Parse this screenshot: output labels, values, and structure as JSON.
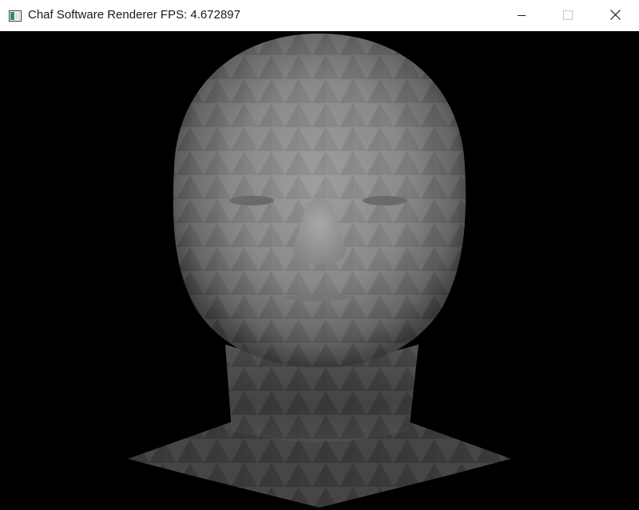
{
  "window": {
    "title": "Chaf Software Renderer FPS: 4.672897",
    "icons": {
      "app": "app-window-icon",
      "minimize": "minimize-icon",
      "maximize": "maximize-icon",
      "close": "close-icon"
    }
  },
  "viewport": {
    "background": "#000000",
    "content": "rendered-3d-head-model",
    "shading_colors": [
      "#8a8a8a",
      "#6e6e6e",
      "#3a3a3a"
    ]
  }
}
